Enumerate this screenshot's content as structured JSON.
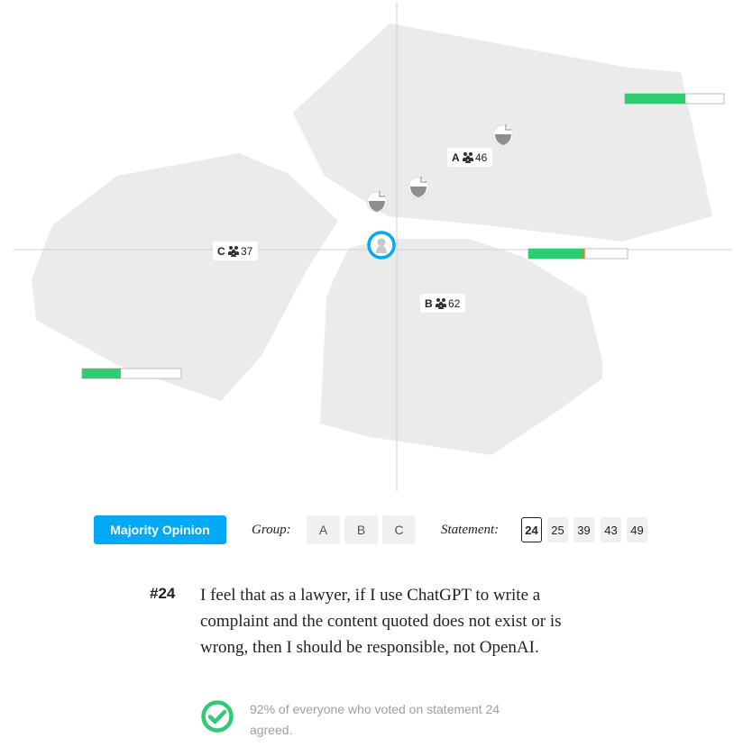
{
  "map": {
    "groups": [
      {
        "letter": "A",
        "count": "46",
        "icon": "people-icon"
      },
      {
        "letter": "B",
        "count": "62",
        "icon": "people-icon"
      },
      {
        "letter": "C",
        "count": "37",
        "icon": "people-icon"
      }
    ],
    "agreement_bars": [
      {
        "group": "A",
        "agree_fraction": 0.61,
        "disagree_fraction": 0.0
      },
      {
        "group": "B",
        "agree_fraction": 0.55,
        "disagree_fraction": 0.02
      },
      {
        "group": "C",
        "agree_fraction": 0.39,
        "disagree_fraction": 0.0
      }
    ],
    "colors": {
      "hull": "#ebebeb",
      "axis": "#d0d0d0",
      "agree": "#2ecc71",
      "disagree": "#e67e22",
      "self_ring": "#03a9f4"
    },
    "self_icon": "user-icon",
    "participant_icon": "avatar-icon"
  },
  "controls": {
    "majority_label": "Majority Opinion",
    "group_label": "Group:",
    "groups": [
      "A",
      "B",
      "C"
    ],
    "statement_label": "Statement:",
    "statements": [
      "24",
      "25",
      "39",
      "43",
      "49"
    ],
    "active_statement": "24"
  },
  "statement": {
    "number": "#24",
    "text": "I feel that as a lawyer, if I use ChatGPT to write a complaint and the content quoted does not exist or is wrong, then I should be responsible, not OpenAI.",
    "agree_text": "92% of everyone who voted on statement 24 agreed.",
    "check_icon": "check-circle-icon",
    "check_color": "#2ecc71"
  }
}
